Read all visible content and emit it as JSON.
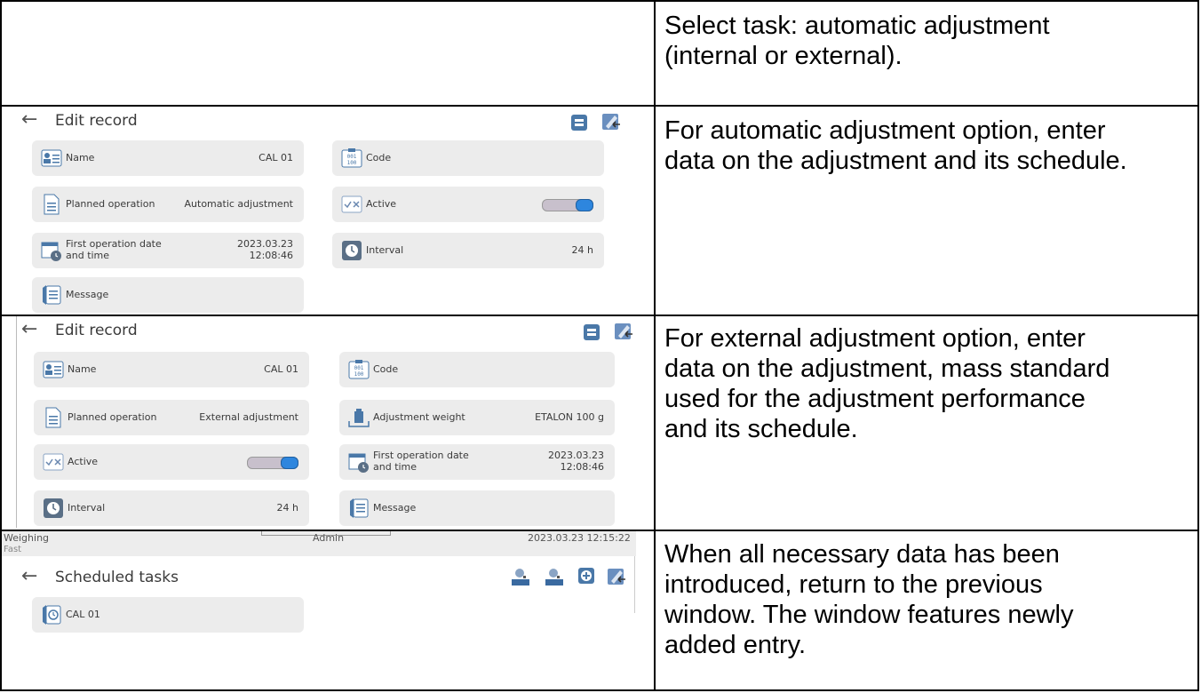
{
  "rows": [
    {
      "desc": "Select task: automatic adjustment\n(internal or external)."
    },
    {
      "desc": "For automatic adjustment option, enter\ndata on the adjustment and its schedule."
    },
    {
      "desc": "For external adjustment option, enter\ndata on the adjustment, mass standard\nused for the adjustment performance\nand its schedule."
    },
    {
      "desc": "When all necessary data has been\nintroduced, return to the previous\nwindow. The window features newly\nadded entry."
    }
  ],
  "panel1": {
    "back": "←",
    "title": "Edit record",
    "name_label": "Name",
    "name_value": "CAL 01",
    "code_label": "Code",
    "planned_label": "Planned operation",
    "planned_value": "Automatic adjustment",
    "active_label": "Active",
    "first_label": "First operation date and time",
    "first_date": "2023.03.23",
    "first_time": "12:08:46",
    "interval_label": "Interval",
    "interval_value": "24 h",
    "message_label": "Message"
  },
  "panel2": {
    "back": "←",
    "title": "Edit record",
    "name_label": "Name",
    "name_value": "CAL 01",
    "code_label": "Code",
    "planned_label": "Planned operation",
    "planned_value": "External adjustment",
    "weight_label": "Adjustment weight",
    "weight_value": "ETALON 100 g",
    "active_label": "Active",
    "first_label": "First operation date and time",
    "first_date": "2023.03.23",
    "first_time": "12:08:46",
    "interval_label": "Interval",
    "interval_value": "24 h",
    "message_label": "Message"
  },
  "panel3": {
    "mode": "Weighing",
    "submode": "Fast",
    "user": "Admin",
    "datetime": "2023.03.23 12:15:22",
    "back": "←",
    "title": "Scheduled tasks",
    "item_label": "CAL 01"
  },
  "icons": {
    "name": "name-list-icon",
    "code": "code-icon",
    "doc": "document-icon",
    "check": "check-x-icon",
    "calendar": "calendar-clock-icon",
    "clock": "clock-icon",
    "message": "message-icon",
    "weight": "weight-icon",
    "print": "print-icon",
    "exit": "exit-edit-icon",
    "search_name": "search-name-icon",
    "search_code": "search-code-icon",
    "add": "add-icon"
  },
  "accent": "#2e86de"
}
